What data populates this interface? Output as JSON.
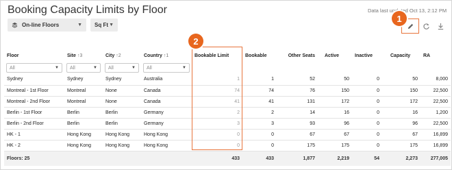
{
  "header": {
    "title": "Booking Capacity Limits by Floor",
    "updated": "Data last updated Oct 13, 2:12 PM"
  },
  "toolbar": {
    "floors_label": "On-line Floors",
    "unit_label": "Sq Ft",
    "icons": [
      "edit-icon",
      "refresh-icon",
      "download-icon"
    ]
  },
  "callouts": {
    "one": "1",
    "two": "2"
  },
  "columns": {
    "floor": "Floor",
    "site": "Site",
    "site_sort": "↑3",
    "city": "City",
    "city_sort": "↑2",
    "country": "Country",
    "country_sort": "↑1",
    "bookable_limit": "Bookable Limit",
    "bookable": "Bookable",
    "other_seats": "Other Seats",
    "active": "Active",
    "inactive": "Inactive",
    "capacity": "Capacity",
    "ra": "RA"
  },
  "filters": {
    "floor": "All",
    "site": "All",
    "city": "All",
    "country": "All"
  },
  "rows": [
    {
      "floor": "Sydney",
      "site": "Sydney",
      "city": "Sydney",
      "country": "Australia",
      "bookable_limit": "1",
      "bookable": "1",
      "other_seats": "52",
      "active": "50",
      "inactive": "0",
      "capacity": "50",
      "ra": "8,000"
    },
    {
      "floor": "Montreal - 1st Floor",
      "site": "Montreal",
      "city": "None",
      "country": "Canada",
      "bookable_limit": "74",
      "bookable": "74",
      "other_seats": "76",
      "active": "150",
      "inactive": "0",
      "capacity": "150",
      "ra": "22,500"
    },
    {
      "floor": "Montreal - 2nd Floor",
      "site": "Montreal",
      "city": "None",
      "country": "Canada",
      "bookable_limit": "41",
      "bookable": "41",
      "other_seats": "131",
      "active": "172",
      "inactive": "0",
      "capacity": "172",
      "ra": "22,500"
    },
    {
      "floor": "Berlin - 1st Floor",
      "site": "Berlin",
      "city": "Berlin",
      "country": "Germany",
      "bookable_limit": "2",
      "bookable": "2",
      "other_seats": "14",
      "active": "16",
      "inactive": "0",
      "capacity": "16",
      "ra": "1,200"
    },
    {
      "floor": "Berlin - 2nd Floor",
      "site": "Berlin",
      "city": "Berlin",
      "country": "Germany",
      "bookable_limit": "3",
      "bookable": "3",
      "other_seats": "93",
      "active": "96",
      "inactive": "0",
      "capacity": "96",
      "ra": "22,500"
    },
    {
      "floor": "HK - 1",
      "site": "Hong Kong",
      "city": "Hong Kong",
      "country": "Hong Kong",
      "bookable_limit": "0",
      "bookable": "0",
      "other_seats": "67",
      "active": "67",
      "inactive": "0",
      "capacity": "67",
      "ra": "16,899"
    },
    {
      "floor": "HK - 2",
      "site": "Hong Kong",
      "city": "Hong Kong",
      "country": "Hong Kong",
      "bookable_limit": "0",
      "bookable": "0",
      "other_seats": "175",
      "active": "175",
      "inactive": "0",
      "capacity": "175",
      "ra": "16,899"
    }
  ],
  "totals": {
    "floor": "Floors: 25",
    "bookable_limit": "433",
    "bookable": "433",
    "other_seats": "1,877",
    "active": "2,219",
    "inactive": "54",
    "capacity": "2,273",
    "ra": "277,005"
  },
  "colors": {
    "accent": "#e8661e",
    "highlight_border": "#e8743b"
  }
}
